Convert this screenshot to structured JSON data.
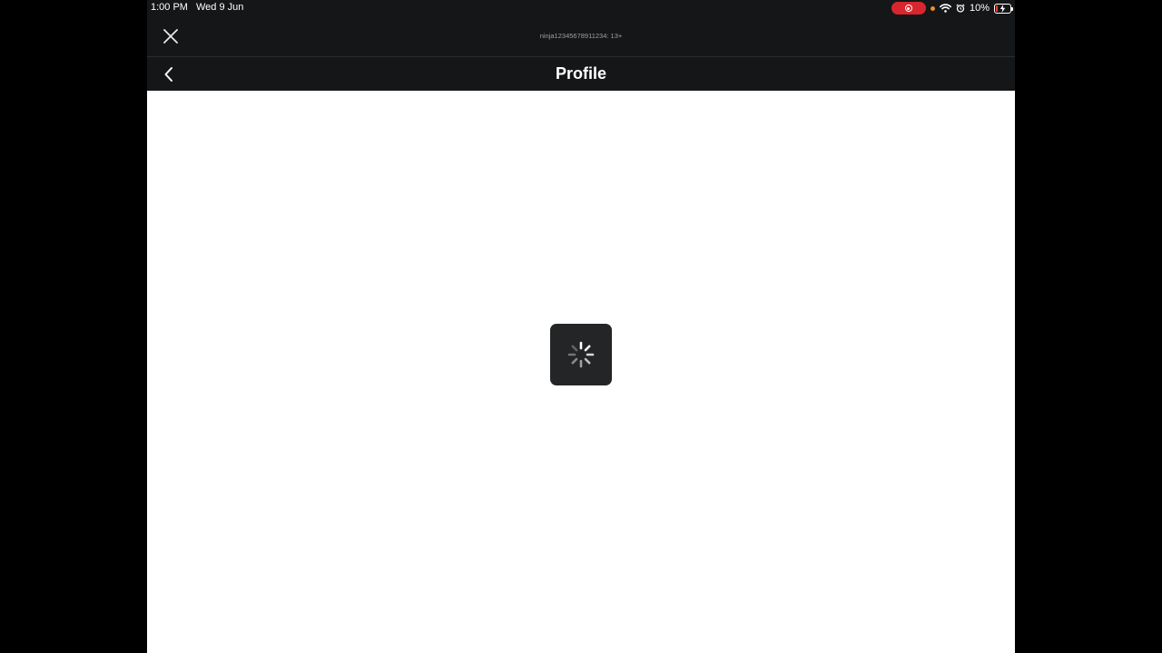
{
  "status_bar": {
    "time": "1:00 PM",
    "date": "Wed 9 Jun",
    "battery_percent": "10%",
    "battery_level": 0.1,
    "icons": [
      "screen-record-icon",
      "orange-dot-indicator",
      "wifi-icon",
      "alarm-icon",
      "battery-charging-icon"
    ]
  },
  "top_bar": {
    "username": "ninja12345678911234: 13+",
    "close_icon": "close-icon"
  },
  "header": {
    "title": "Profile",
    "back_icon": "chevron-left-icon"
  },
  "content": {
    "state": "loading",
    "spinner_icon": "loading-spinner-icon"
  },
  "colors": {
    "bar_background": "#141618",
    "content_background": "#ffffff",
    "spinner_box": "#232527",
    "record_pill": "#d7262d"
  }
}
